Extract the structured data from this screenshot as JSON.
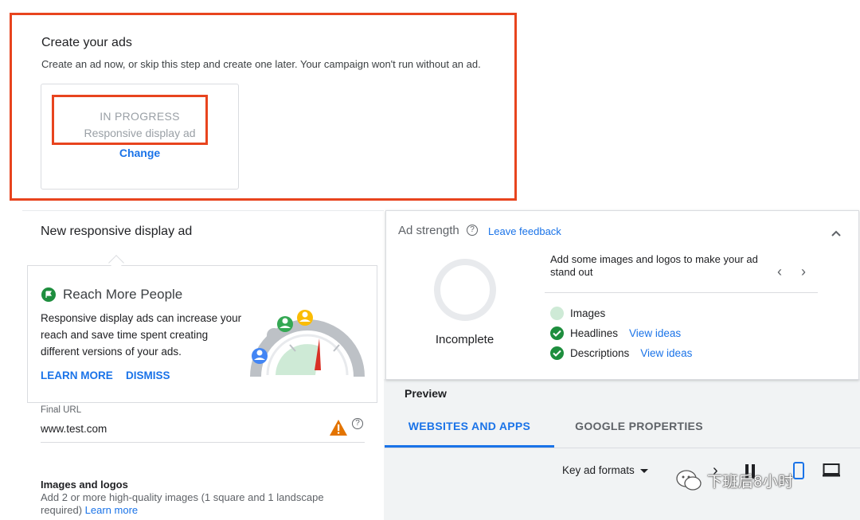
{
  "create_ads": {
    "title": "Create your ads",
    "description": "Create an ad now, or skip this step and create one later. Your campaign won't run without an ad.",
    "ad_card": {
      "status": "IN PROGRESS",
      "type": "Responsive display ad",
      "change_label": "Change"
    }
  },
  "editor": {
    "title": "New responsive display ad",
    "reach_card": {
      "title": "Reach More People",
      "body": "Responsive display ads can increase your reach and save time spent creating different versions of your ads.",
      "learn_more": "LEARN MORE",
      "dismiss": "DISMISS"
    },
    "final_url": {
      "label": "Final URL",
      "value": "www.test.com",
      "help": "?"
    },
    "images": {
      "title": "Images and logos",
      "description": "Add 2 or more high-quality images (1 square and 1 landscape required)",
      "learn_more": "Learn more"
    }
  },
  "ad_strength": {
    "label": "Ad strength",
    "help": "?",
    "leave_feedback": "Leave feedback",
    "status": "Incomplete",
    "tip": "Add some images and logos to make your ad stand out",
    "prev": "‹",
    "next": "›",
    "checklist": [
      {
        "label": "Images",
        "done": false,
        "action": ""
      },
      {
        "label": "Headlines",
        "done": true,
        "action": "View ideas"
      },
      {
        "label": "Descriptions",
        "done": true,
        "action": "View ideas"
      }
    ]
  },
  "preview": {
    "title": "Preview",
    "tabs": [
      "WEBSITES AND APPS",
      "GOOGLE PROPERTIES"
    ],
    "active_tab": "WEBSITES AND APPS",
    "formats_select": "Key ad formats",
    "next_icon": "›"
  },
  "watermark": "下班后8小时",
  "colors": {
    "highlight": "#e8441e",
    "link": "#1a73e8",
    "success": "#1e8e3e",
    "warning": "#e37400"
  }
}
